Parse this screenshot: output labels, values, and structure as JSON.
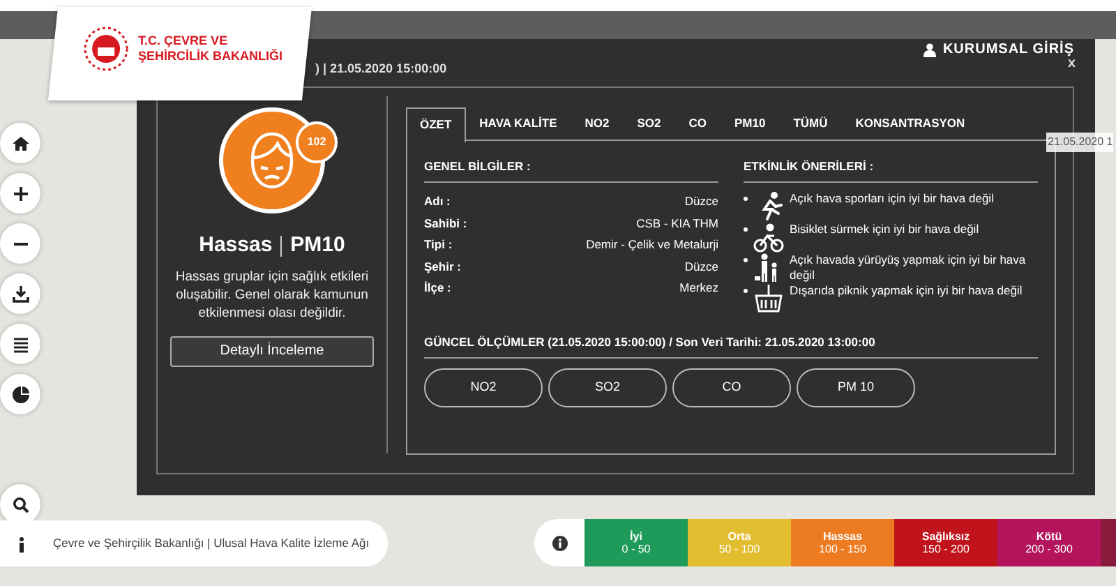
{
  "logo": {
    "line_1": "T.C. ÇEVRE VE",
    "line_2": "ŞEHİRCİLİK BAKANLIĞI"
  },
  "header": {
    "login": "KURUMSAL GİRİŞ",
    "map_date": "21.05.2020 1"
  },
  "modal": {
    "title": ") | 21.05.2020 15:00:00",
    "close": "x",
    "status": {
      "index": "102",
      "category": "Hassas",
      "pollutant": "PM10",
      "description": "Hassas gruplar için sağlık etkileri oluşabilir. Genel olarak kamunun etkilenmesi olası değildir.",
      "button": "Detaylı İnceleme",
      "color": "#f07f1e"
    },
    "tabs": [
      {
        "label": "ÖZET",
        "selected": true
      },
      {
        "label": "HAVA KALİTE",
        "selected": false
      },
      {
        "label": "NO2",
        "selected": false
      },
      {
        "label": "SO2",
        "selected": false
      },
      {
        "label": "CO",
        "selected": false
      },
      {
        "label": "PM10",
        "selected": false
      },
      {
        "label": "TÜMÜ",
        "selected": false
      },
      {
        "label": "KONSANTRASYON",
        "selected": false
      }
    ],
    "general_info": {
      "title": "GENEL BİLGİLER :",
      "rows": [
        {
          "label": "Adı :",
          "value": "Düzce"
        },
        {
          "label": "Sahibi :",
          "value": "CSB - KIA THM"
        },
        {
          "label": "Tipi :",
          "value": "Demir - Çelik ve Metalurji"
        },
        {
          "label": "Şehir :",
          "value": "Düzce"
        },
        {
          "label": "İlçe :",
          "value": "Merkez"
        }
      ]
    },
    "activities": {
      "title": "ETKİNLİK ÖNERİLERİ :",
      "items": [
        {
          "kind": "run",
          "text": "Açık hava sporları için iyi bir hava değil"
        },
        {
          "kind": "bike",
          "text": "Bisiklet sürmek için iyi bir hava değil"
        },
        {
          "kind": "walk",
          "text": "Açık havada yürüyüş yapmak için iyi bir hava değil"
        },
        {
          "kind": "picnic",
          "text": "Dışarıda piknik yapmak için iyi bir hava değil"
        }
      ]
    },
    "measurements": {
      "title": "GÜNCEL ÖLÇÜMLER (21.05.2020 15:00:00) / Son Veri Tarihi: 21.05.2020 13:00:00",
      "buttons": [
        "NO2",
        "SO2",
        "CO",
        "PM 10"
      ]
    }
  },
  "map_controls": [
    {
      "kind": "home"
    },
    {
      "kind": "zoom-in"
    },
    {
      "kind": "zoom-out"
    },
    {
      "kind": "download"
    },
    {
      "kind": "list"
    },
    {
      "kind": "chart"
    },
    {
      "kind": "search"
    }
  ],
  "attribution": "Çevre ve Şehirçilik Bakanlığı | Ulusal Hava Kalite İzleme Ağı",
  "legend": [
    {
      "label": "İyi",
      "range": "0 - 50",
      "color": "#1e9a5a"
    },
    {
      "label": "Orta",
      "range": "50 - 100",
      "color": "#e2bd30"
    },
    {
      "label": "Hassas",
      "range": "100 - 150",
      "color": "#ec7b22"
    },
    {
      "label": "Sağlıksız",
      "range": "150 - 200",
      "color": "#c0131c"
    },
    {
      "label": "Kötü",
      "range": "200 - 300",
      "color": "#b3145b"
    },
    {
      "color": "#8a1a3c"
    }
  ]
}
